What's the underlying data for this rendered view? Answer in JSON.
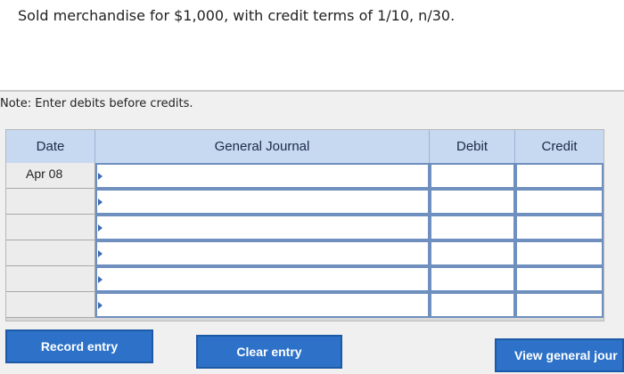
{
  "question": {
    "transaction": "Sold merchandise for $1,000, with credit terms of 1/10, n/30.",
    "note": "Note: Enter debits before credits."
  },
  "journal": {
    "headers": {
      "date": "Date",
      "account": "General Journal",
      "debit": "Debit",
      "credit": "Credit"
    },
    "rows": [
      {
        "date": "Apr 08",
        "account": "",
        "debit": "",
        "credit": ""
      },
      {
        "date": "",
        "account": "",
        "debit": "",
        "credit": ""
      },
      {
        "date": "",
        "account": "",
        "debit": "",
        "credit": ""
      },
      {
        "date": "",
        "account": "",
        "debit": "",
        "credit": ""
      },
      {
        "date": "",
        "account": "",
        "debit": "",
        "credit": ""
      },
      {
        "date": "",
        "account": "",
        "debit": "",
        "credit": ""
      }
    ]
  },
  "buttons": {
    "record": "Record entry",
    "clear": "Clear entry",
    "view": "View general jour"
  },
  "colors": {
    "header_bg": "#c7d9f1",
    "button_bg": "#2d72c8",
    "input_border": "#6f8fbf"
  }
}
